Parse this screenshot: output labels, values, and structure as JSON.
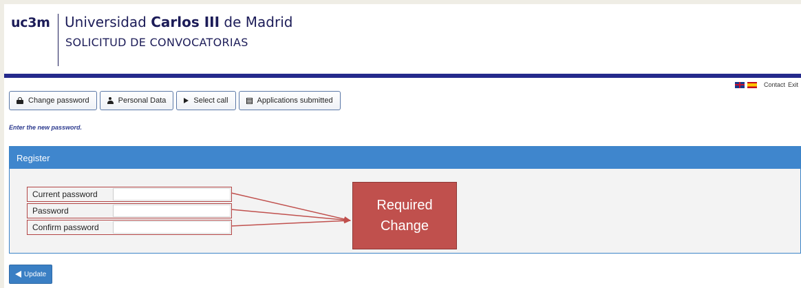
{
  "header": {
    "logo": "uc3m",
    "university_prefix": "Universidad",
    "university_bold": "Carlos III",
    "university_suffix": "de Madrid",
    "app_title": "SOLICITUD DE CONVOCATORIAS"
  },
  "topbar": {
    "flags": [
      "uk-flag-icon",
      "spain-flag-icon"
    ],
    "contact_label": "Contact",
    "exit_label": "Exit"
  },
  "nav": {
    "items": [
      {
        "label": "Change password",
        "icon": "lock-icon"
      },
      {
        "label": "Personal Data",
        "icon": "user-icon"
      },
      {
        "label": "Select call",
        "icon": "play-icon"
      },
      {
        "label": "Applications submitted",
        "icon": "list-icon"
      }
    ]
  },
  "hint": "Enter the new password.",
  "panel": {
    "title": "Register",
    "fields": [
      {
        "label": "Current password",
        "value": ""
      },
      {
        "label": "Password",
        "value": ""
      },
      {
        "label": "Confirm password",
        "value": ""
      }
    ]
  },
  "annotation": {
    "line1": "Required",
    "line2": "Change"
  },
  "update_button": {
    "label": "Update",
    "icon": "send-icon"
  },
  "colors": {
    "accent_band": "#252a8c",
    "panel_header": "#3f86cd",
    "annotation": "#c0504d",
    "button": "#3a7fc4"
  }
}
